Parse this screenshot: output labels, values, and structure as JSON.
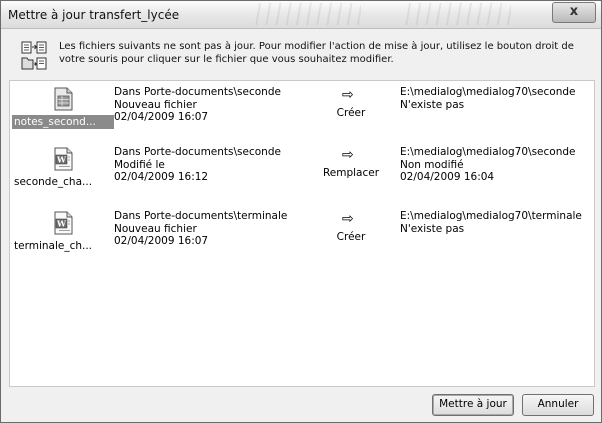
{
  "window": {
    "title": "Mettre à jour transfert_lycée",
    "close_label": "x"
  },
  "info": {
    "icon": "sync-files-icon",
    "text": "Les fichiers suivants ne sont pas à jour. Pour modifier l'action de mise à jour, utilisez le bouton droit de votre souris pour cliquer sur le fichier que vous souhaitez modifier."
  },
  "files": [
    {
      "icon": "spreadsheet-file-icon",
      "name": "notes_second...",
      "selected": true,
      "src_line1": "Dans Porte-documents\\seconde",
      "src_line2": "Nouveau fichier",
      "src_line3": "02/04/2009 16:07",
      "arrow": "⇨",
      "action": "Créer",
      "dst_line1": "E:\\medialog\\medialog70\\seconde",
      "dst_line2": "N'existe pas",
      "dst_line3": ""
    },
    {
      "icon": "word-file-icon",
      "name": "seconde_cha...",
      "selected": false,
      "src_line1": "Dans Porte-documents\\seconde",
      "src_line2": "Modifié le",
      "src_line3": "02/04/2009 16:12",
      "arrow": "⇨",
      "action": "Remplacer",
      "dst_line1": "E:\\medialog\\medialog70\\seconde",
      "dst_line2": "Non modifié",
      "dst_line3": "02/04/2009 16:04"
    },
    {
      "icon": "word-file-icon",
      "name": "terminale_ch...",
      "selected": false,
      "src_line1": "Dans Porte-documents\\terminale",
      "src_line2": "Nouveau fichier",
      "src_line3": "02/04/2009 16:07",
      "arrow": "⇨",
      "action": "Créer",
      "dst_line1": "E:\\medialog\\medialog70\\terminale",
      "dst_line2": "N'existe pas",
      "dst_line3": ""
    }
  ],
  "buttons": {
    "update_label": "Mettre à jour",
    "cancel_label": "Annuler"
  }
}
